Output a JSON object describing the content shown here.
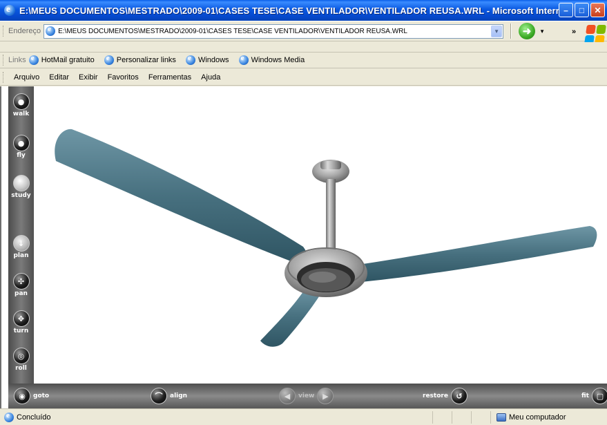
{
  "window": {
    "title": "E:\\MEUS DOCUMENTOS\\MESTRADO\\2009-01\\CASES TESE\\CASE VENTILADOR\\VENTILADOR REUSA.WRL - Microsoft Internet E...",
    "controls": {
      "minimize": "–",
      "maximize": "□",
      "close": "✕"
    }
  },
  "address_bar": {
    "label": "Endereço",
    "value": "E:\\MEUS DOCUMENTOS\\MESTRADO\\2009-01\\CASES TESE\\CASE VENTILADOR\\VENTILADOR REUSA.WRL",
    "chevron": "»"
  },
  "links_bar": {
    "label": "Links",
    "items": [
      "HotMail gratuito",
      "Personalizar links",
      "Windows",
      "Windows Media"
    ]
  },
  "menu": [
    "Arquivo",
    "Editar",
    "Exibir",
    "Favoritos",
    "Ferramentas",
    "Ajuda"
  ],
  "vrml_nav": {
    "left": [
      "walk",
      "fly",
      "study",
      "plan",
      "pan",
      "turn",
      "roll"
    ],
    "bottom": {
      "goto": "goto",
      "align": "align",
      "view": "view",
      "restore": "restore",
      "fit": "fit"
    }
  },
  "status": {
    "text": "Concluído",
    "zone": "Meu computador"
  },
  "colors": {
    "titlebar": "#0a58e0",
    "blade": "#4a7585",
    "chrome": "#9a9a9a"
  }
}
